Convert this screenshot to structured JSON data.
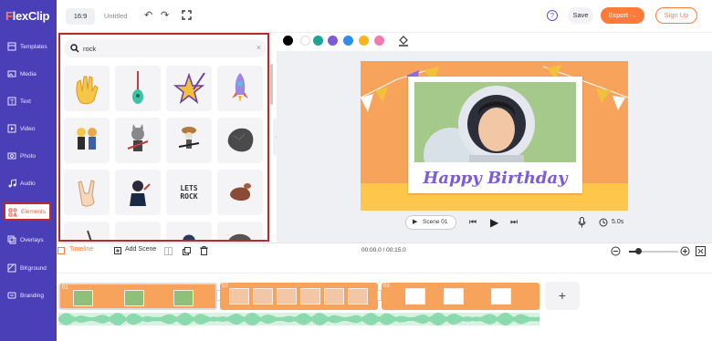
{
  "app": {
    "logo": "lexClip",
    "logo_f": "F"
  },
  "sidebar": {
    "items": [
      {
        "label": "Templates"
      },
      {
        "label": "Media"
      },
      {
        "label": "Text"
      },
      {
        "label": "Video"
      },
      {
        "label": "Photo"
      },
      {
        "label": "Audio"
      },
      {
        "label": "Elements"
      },
      {
        "label": "Overlays"
      },
      {
        "label": "BKground"
      },
      {
        "label": "Branding"
      }
    ],
    "active": "Elements"
  },
  "topbar": {
    "ratio": "16:9",
    "title": "Untitled",
    "help": "?",
    "save": "Save",
    "export": "Export →",
    "signup": "Sign Up"
  },
  "search": {
    "value": "rock",
    "clear": "×"
  },
  "stickers": {
    "lets_rock_text": "LETS ROCK"
  },
  "colors": {
    "swatches": [
      "#000000",
      "#ffffff",
      "#1ba798",
      "#7b5bd6",
      "#2f8de4",
      "#f9b51e",
      "#f07ab2"
    ],
    "accent": "#ff7b39",
    "sidebar": "#4b3fb8"
  },
  "canvas": {
    "headline": "Happy Birthday"
  },
  "player": {
    "scene": "Scene 01",
    "duration": "5.0s"
  },
  "timeline": {
    "tab": "Timeline",
    "add_scene": "Add Scene",
    "time": "00:00.0 / 00:15.0",
    "zoom_level": 0.2,
    "clips": [
      {
        "num": "01"
      },
      {
        "num": "02"
      },
      {
        "num": "03"
      }
    ],
    "add_button": "+"
  }
}
